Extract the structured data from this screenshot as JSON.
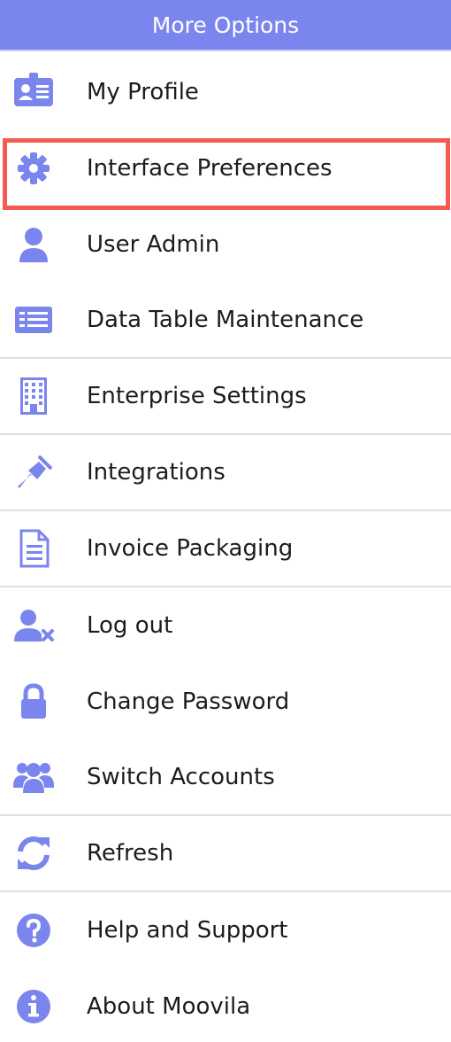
{
  "header": {
    "title": "More Options"
  },
  "colors": {
    "accent": "#7b85ee",
    "highlight": "#f25c52",
    "icon": "#7b85ee"
  },
  "highlighted_item": "Interface Preferences",
  "items": [
    {
      "label": "My Profile",
      "icon": "profile-card-icon"
    },
    {
      "label": "Interface Preferences",
      "icon": "gear-icon"
    },
    {
      "label": "User Admin",
      "icon": "user-icon"
    },
    {
      "label": "Data Table Maintenance",
      "icon": "table-list-icon"
    },
    {
      "label": "Enterprise Settings",
      "icon": "building-icon"
    },
    {
      "label": "Integrations",
      "icon": "plug-icon"
    },
    {
      "label": "Invoice Packaging",
      "icon": "document-icon"
    },
    {
      "label": "Log out",
      "icon": "user-times-icon"
    },
    {
      "label": "Change Password",
      "icon": "lock-icon"
    },
    {
      "label": "Switch Accounts",
      "icon": "users-group-icon"
    },
    {
      "label": "Refresh",
      "icon": "refresh-icon"
    },
    {
      "label": "Help and Support",
      "icon": "question-circle-icon"
    },
    {
      "label": "About Moovila",
      "icon": "info-circle-icon"
    }
  ]
}
